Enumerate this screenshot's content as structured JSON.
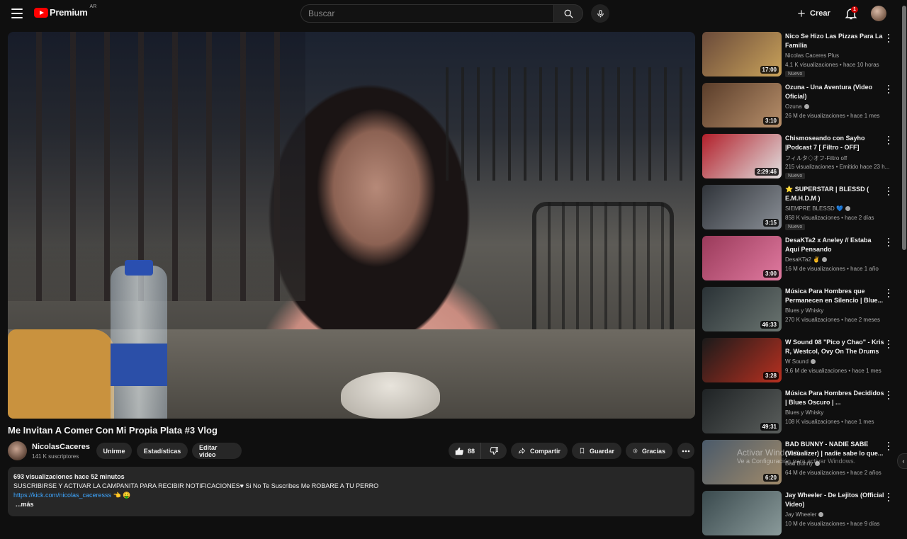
{
  "header": {
    "logo_text": "Premium",
    "country": "AR",
    "search_placeholder": "Buscar",
    "create_label": "Crear",
    "notifications_count": "1"
  },
  "video": {
    "title": "Me Invitan A Comer Con Mi Propia Plata #3 Vlog",
    "channel": "NicolasCaceres",
    "subscribers": "141 K suscriptores",
    "join_label": "Unirme",
    "stats_label": "Estadísticas",
    "edit_label": "Editar video",
    "likes": "88",
    "share_label": "Compartir",
    "save_label": "Guardar",
    "thanks_label": "Gracias"
  },
  "description": {
    "stats": "693 visualizaciones  hace 52 minutos",
    "text": "SUSCRIBIRSE Y ACTIVAR LA CAMPANITA PARA RECIBIR NOTIFICACIONES♥  Si No Te Suscribes Me ROBARE A TU PERRO",
    "link": "https://kick.com/nicolas_caceresss",
    "link_suffix": " 👈 🤑",
    "more": "...más"
  },
  "recommendations": [
    {
      "title": "Nico Se Hizo Las Pizzas Para La Familia",
      "channel": "Nicolas Caceres Plus",
      "meta": "4,1 K visualizaciones • hace 10 horas",
      "duration": "17:00",
      "badge": "Nuevo",
      "verified": false,
      "colors": [
        "#6a4a3a",
        "#c9a25a"
      ]
    },
    {
      "title": "Ozuna - Una Aventura (Video Oficial)",
      "channel": "Ozuna",
      "meta": "26 M de visualizaciones • hace 1 mes",
      "duration": "3:10",
      "badge": "",
      "verified": true,
      "colors": [
        "#5a3d2a",
        "#b78f6a"
      ]
    },
    {
      "title": "Chismoseando con Sayho |Podcast 7 [ Filtro - OFF]",
      "channel": "フィルタ◇オフ-Filtro off",
      "meta": "215 visualizaciones • Emitido hace 23 h...",
      "duration": "2:29:46",
      "badge": "Nuevo",
      "verified": false,
      "colors": [
        "#b21f2a",
        "#e0e0e0"
      ]
    },
    {
      "title": "⭐ SUPERSTAR | BLESSD ( E.M.H.D.M )",
      "channel": "SIEMPRE BLESSD 💙",
      "meta": "858 K visualizaciones • hace 2 días",
      "duration": "3:15",
      "badge": "Nuevo",
      "verified": true,
      "colors": [
        "#30343a",
        "#8a8f96"
      ]
    },
    {
      "title": "DesaKTa2 x Aneley  // Estaba Aquí Pensando",
      "channel": "DesaKTa2 ✌",
      "meta": "16 M de visualizaciones • hace 1 año",
      "duration": "3:00",
      "badge": "",
      "verified": true,
      "colors": [
        "#9a3a5a",
        "#e07aa0"
      ]
    },
    {
      "title": "Música Para Hombres que Permanecen en Silencio | Blue...",
      "channel": "Blues y Whisky",
      "meta": "270 K visualizaciones • hace 2 meses",
      "duration": "46:33",
      "badge": "",
      "verified": false,
      "colors": [
        "#2a3236",
        "#6a7470"
      ]
    },
    {
      "title": "W Sound 08 \"Pico y Chao\" - Kris R, Westcol, Ovy On The Drums",
      "channel": "W Sound",
      "meta": "9,6 M de visualizaciones • hace 1 mes",
      "duration": "3:28",
      "badge": "",
      "verified": true,
      "colors": [
        "#1a1a1a",
        "#b83020"
      ]
    },
    {
      "title": "Música Para Hombres Decididos | Blues Oscuro | ...",
      "channel": "Blues y Whisky",
      "meta": "108 K visualizaciones • hace 1 mes",
      "duration": "49:31",
      "badge": "",
      "verified": false,
      "colors": [
        "#1e2224",
        "#5a5e5c"
      ]
    },
    {
      "title": "BAD BUNNY -  NADIE SABE (Visualizer) | nadie sabe lo que...",
      "channel": "Bad Bunny",
      "meta": "64 M de visualizaciones • hace 2 años",
      "duration": "6:20",
      "badge": "",
      "verified": true,
      "colors": [
        "#4a5a6a",
        "#a08a6a"
      ]
    },
    {
      "title": "Jay Wheeler - De Lejitos (Official Video)",
      "channel": "Jay Wheeler",
      "meta": "10 M de visualizaciones • hace 9 días",
      "duration": "",
      "badge": "",
      "verified": true,
      "colors": [
        "#3a4a4e",
        "#8a9a9a"
      ]
    }
  ],
  "watermark": {
    "title": "Activar Windows",
    "subtitle": "Ve a Configuración para activar Windows."
  }
}
